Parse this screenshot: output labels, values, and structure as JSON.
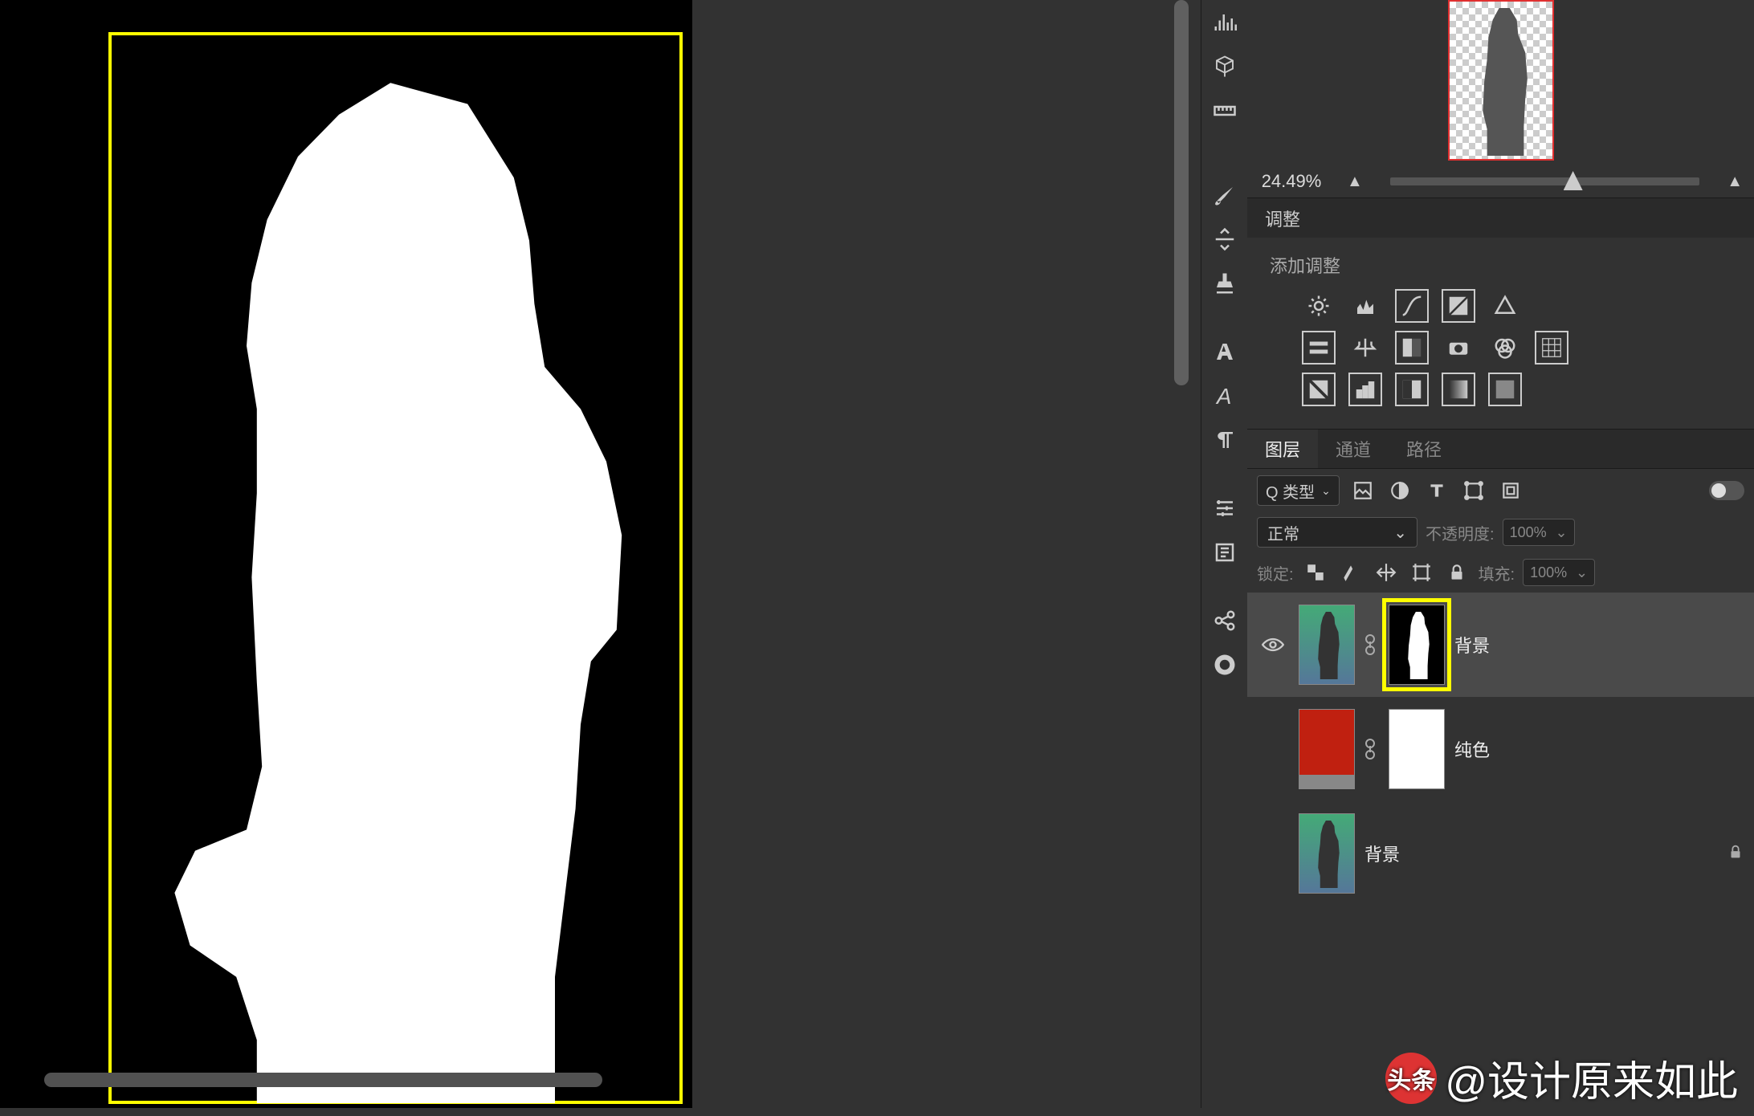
{
  "zoom": {
    "value": "24.49%"
  },
  "adjustments": {
    "panel_title": "调整",
    "add_label": "添加调整"
  },
  "layers_panel": {
    "tabs": {
      "layers": "图层",
      "channels": "通道",
      "paths": "路径"
    },
    "filter_dropdown": "Q 类型",
    "blend_mode": "正常",
    "opacity_label": "不透明度:",
    "opacity_value": "100%",
    "lock_label": "锁定:",
    "fill_label": "填充:",
    "fill_value": "100%",
    "layers": [
      {
        "name": "背景",
        "type": "masked-photo",
        "visible": true,
        "selected_mask": true
      },
      {
        "name": "纯色",
        "type": "solid-color",
        "visible": false
      },
      {
        "name": "背景",
        "type": "photo",
        "visible": false,
        "locked": true
      }
    ]
  },
  "watermark": {
    "badge": "头条",
    "handle": "@设计原来如此"
  }
}
